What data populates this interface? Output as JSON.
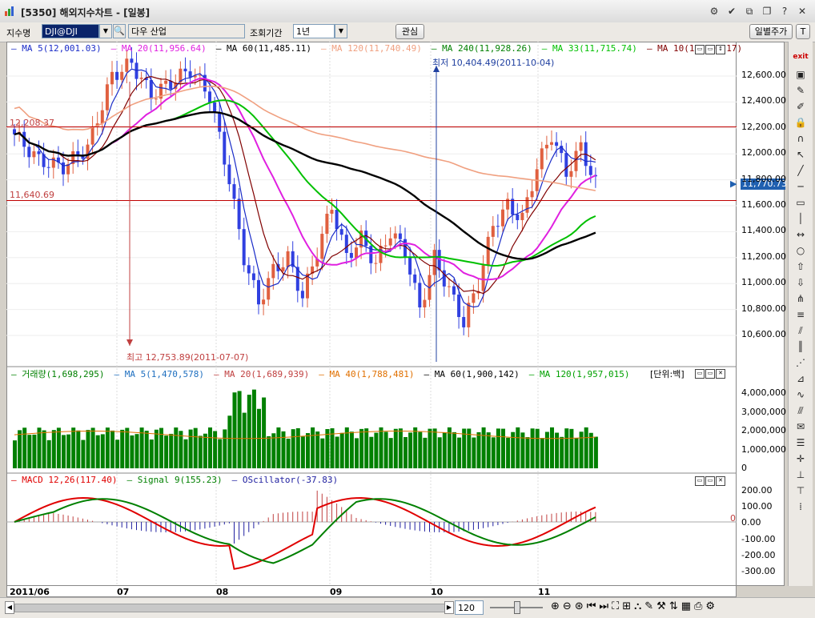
{
  "window": {
    "title": "[5350] 해외지수차트 - [일봉]",
    "btns": [
      "⚙",
      "✔",
      "⧉",
      "⧉",
      "?",
      "✕"
    ]
  },
  "toolbar": {
    "symbol_label": "지수명",
    "symbol_value": "DJI@DJI",
    "name_value": "다우 산업",
    "period_label": "조회기간",
    "period_value": "1년",
    "watch_label": "관심",
    "daily_label": "일별주가",
    "t_label": "T"
  },
  "price_legend": [
    {
      "text": "MA 5(12,001.03)",
      "color": "#1a2cc8"
    },
    {
      "text": "MA 20(11,956.64)",
      "color": "#e020e0"
    },
    {
      "text": "MA 60(11,485.11)",
      "color": "#000000"
    },
    {
      "text": "MA 120(11,740.49)",
      "color": "#f0a080"
    },
    {
      "text": "MA 240(11,928.26)",
      "color": "#008000"
    },
    {
      "text": "MA 33(11,715.74)",
      "color": "#00c000"
    },
    {
      "text": "MA 10(11,990.17)",
      "color": "#800000"
    }
  ],
  "price_axis": [
    "12,600.00",
    "12,400.00",
    "12,200.00",
    "12,000.00",
    "11,800.00",
    "11,600.00",
    "11,400.00",
    "11,200.00",
    "11,000.00",
    "10,800.00",
    "10,600.00"
  ],
  "current_price": "11,770.73",
  "hlines": {
    "upper": "12,208.37",
    "lower": "11,640.69"
  },
  "annotations": {
    "low": "최저 10,404.49(2011-10-04)",
    "high": "최고 12,753.89(2011-07-07)"
  },
  "volume_legend": [
    {
      "text": "거래량(1,698,295)",
      "color": "#008000"
    },
    {
      "text": "MA 5(1,470,578)",
      "color": "#2070c0"
    },
    {
      "text": "MA 20(1,689,939)",
      "color": "#c04040"
    },
    {
      "text": "MA 40(1,788,481)",
      "color": "#e07000"
    },
    {
      "text": "MA 60(1,900,142)",
      "color": "#000000"
    },
    {
      "text": "MA 120(1,957,015)",
      "color": "#00a000"
    }
  ],
  "volume_unit": "[단위:백]",
  "volume_axis": [
    "4,000,000",
    "3,000,000",
    "2,000,000",
    "1,000,000",
    "0"
  ],
  "macd_legend": [
    {
      "text": "MACD 12,26(117.40)",
      "color": "#e00000"
    },
    {
      "text": "Signal 9(155.23)",
      "color": "#008000"
    },
    {
      "text": "OScillator(-37.83)",
      "color": "#2020a0"
    }
  ],
  "macd_axis": [
    "200.00",
    "100.00",
    "0.00",
    "-100.00",
    "-200.00",
    "-300.00"
  ],
  "macd_zero": "0",
  "x_axis": [
    "2011/06",
    "07",
    "08",
    "09",
    "10",
    "11"
  ],
  "bottom": {
    "zoom": "120"
  },
  "colors": {
    "up": "#e06040",
    "down": "#3040e0",
    "volume": "#008000",
    "hline": "#c00000"
  }
}
